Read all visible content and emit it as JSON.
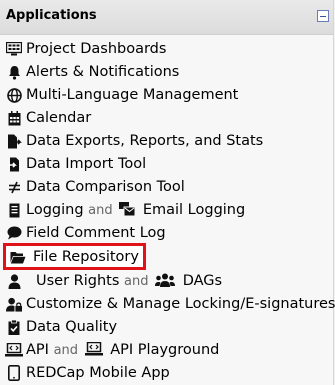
{
  "panel": {
    "title": "Applications"
  },
  "items": [
    {
      "label": "Project Dashboards",
      "icon": "dashboard-icon"
    },
    {
      "label": "Alerts & Notifications",
      "icon": "bell-icon"
    },
    {
      "label": "Multi-Language Management",
      "icon": "globe-icon"
    },
    {
      "label": "Calendar",
      "icon": "calendar-icon"
    },
    {
      "label": "Data Exports, Reports, and Stats",
      "icon": "file-export-icon"
    },
    {
      "label": "Data Import Tool",
      "icon": "file-import-icon"
    },
    {
      "label": "Data Comparison Tool",
      "icon": "not-equal-icon"
    },
    {
      "label": "Logging",
      "sep": "and",
      "label2": "Email Logging",
      "icon": "log-icon",
      "icon2": "mail-bulk-icon"
    },
    {
      "label": "Field Comment Log",
      "icon": "comment-icon"
    },
    {
      "label": "File Repository",
      "icon": "folder-open-icon",
      "highlighted": true,
      "highlight_color": "#e0131b"
    },
    {
      "label": "User Rights",
      "sep": "and",
      "label2": "DAGs",
      "icon": "user-icon",
      "icon2": "users-icon"
    },
    {
      "label": "Customize & Manage Locking/E-signatures",
      "icon": "lock-user-icon"
    },
    {
      "label": "Data Quality",
      "icon": "clipboard-check-icon"
    },
    {
      "label": "API",
      "sep": "and",
      "label2": "API Playground",
      "icon": "laptop-code-icon",
      "icon2": "laptop-code-icon"
    },
    {
      "label": "REDCap Mobile App",
      "icon": "tablet-icon"
    }
  ]
}
